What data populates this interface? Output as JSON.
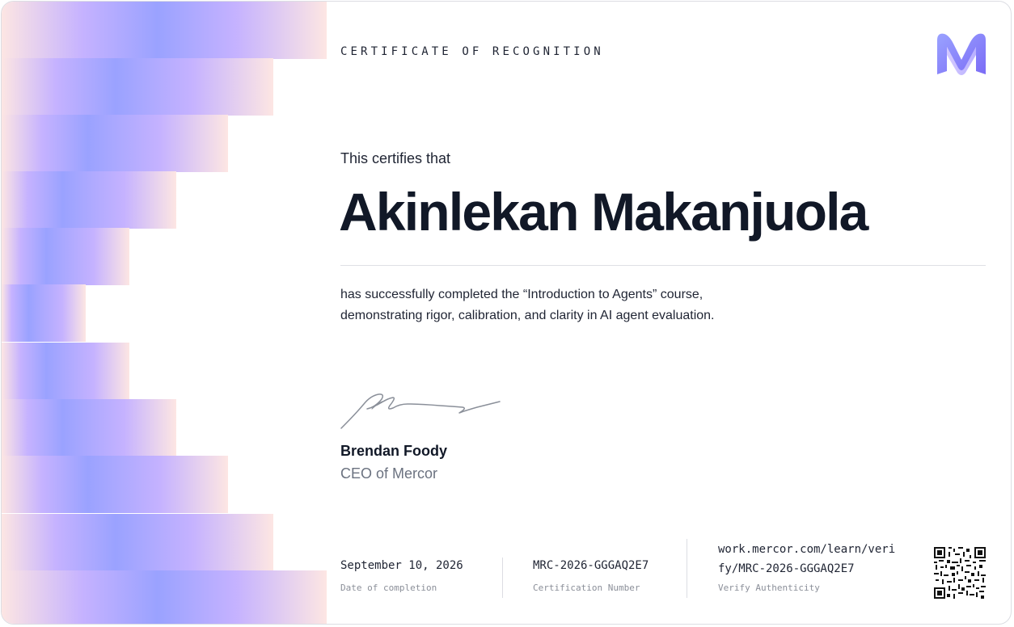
{
  "certificate": {
    "eyebrow": "CERTIFICATE OF RECOGNITION",
    "intro": "This certifies that",
    "recipient_name": "Akinlekan Makanjuola",
    "description_line1": "has successfully completed the “Introduction to Agents” course,",
    "description_line2": "demonstrating rigor, calibration, and clarity in AI agent evaluation.",
    "signer_name": "Brendan Foody",
    "signer_title": "CEO of Mercor"
  },
  "footer": {
    "date_value": "September 10, 2026",
    "date_label": "Date of completion",
    "cert_number_value": "MRC-2026-GGGAQ2E7",
    "cert_number_label": "Certification Number",
    "verify_url_line1": "work.mercor.com/learn/veri",
    "verify_url_line2": "fy/MRC-2026-GGGAQ2E7",
    "verify_label": "Verify Authenticity"
  },
  "icons": {
    "logo": "mercor-logo-icon",
    "signature": "signature-image",
    "qr": "qr-code-icon"
  },
  "colors": {
    "accent_blue": "#9aa2ff",
    "accent_violet": "#c3b1ff",
    "accent_pink": "#fde6e3",
    "text_primary": "#111827",
    "text_muted": "#6b7280"
  }
}
